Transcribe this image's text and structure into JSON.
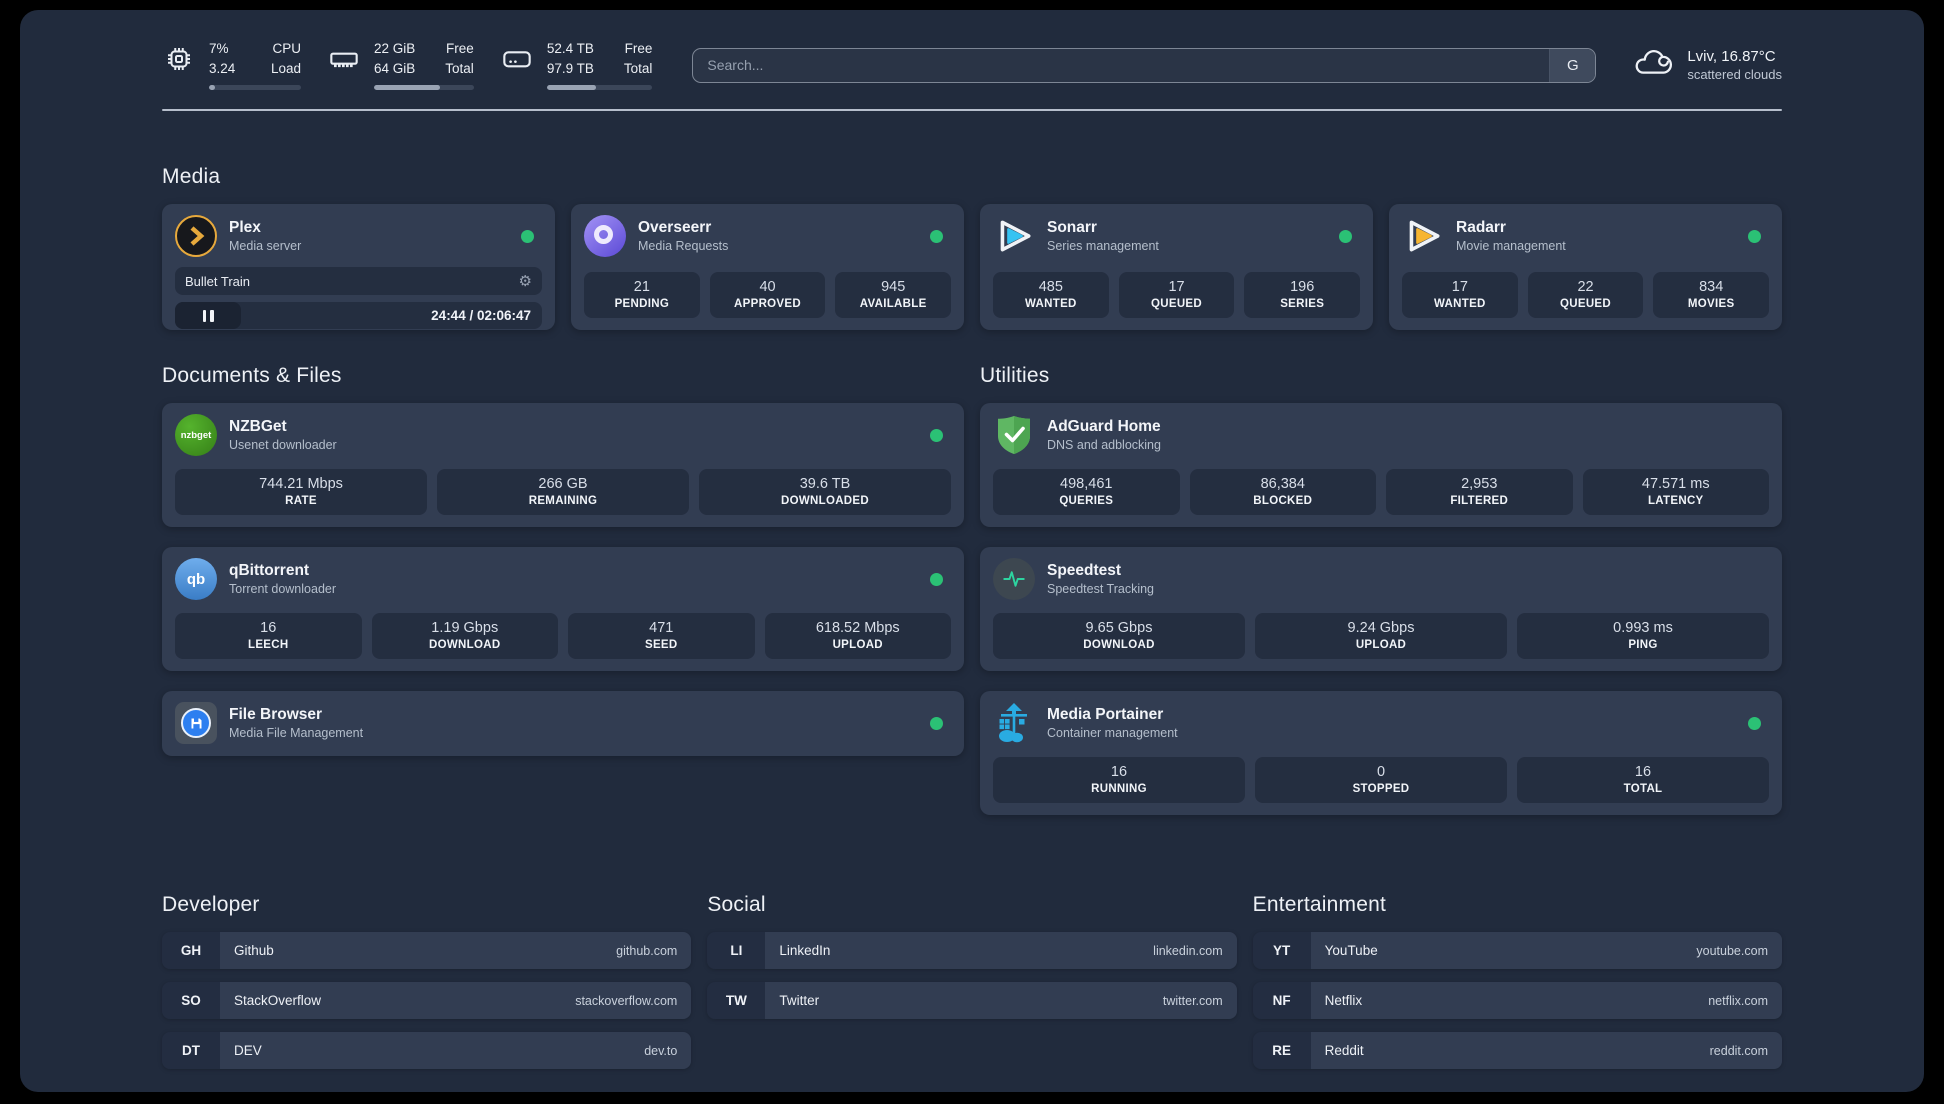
{
  "colors": {
    "background": "#212b3d",
    "card": "#323d52",
    "tile": "#242e40",
    "status_online": "#2bc175",
    "divider": "#c6cedb",
    "plex_accent": "#e7a93c",
    "sonarr_accent": "#36c3f2",
    "radarr_accent": "#f7b530",
    "nzbget_accent": "#42991f",
    "qbittorrent_accent": "#4a90d9",
    "adguard_accent": "#63b663",
    "speedtest_accent": "#2dd4a0",
    "portainer_accent": "#29abe2"
  },
  "icons": {
    "gear": "⚙"
  },
  "header": {
    "cpu": {
      "usage": "7%",
      "load": "3.24",
      "label_top": "CPU",
      "label_bottom": "Load",
      "progress_pct": 7
    },
    "ram": {
      "free": "22 GiB",
      "total": "64 GiB",
      "label_top": "Free",
      "label_bottom": "Total",
      "progress_pct": 66
    },
    "disk": {
      "free": "52.4 TB",
      "total": "97.9 TB",
      "label_top": "Free",
      "label_bottom": "Total",
      "progress_pct": 47
    },
    "search": {
      "placeholder": "Search...",
      "engine": "G"
    },
    "weather": {
      "location": "Lviv, 16.87°C",
      "condition": "scattered clouds"
    }
  },
  "media": {
    "title": "Media",
    "plex": {
      "name": "Plex",
      "desc": "Media server",
      "now_playing": "Bullet Train",
      "time": "24:44 / 02:06:47"
    },
    "overseerr": {
      "name": "Overseerr",
      "desc": "Media Requests",
      "stats": [
        {
          "value": "21",
          "label": "PENDING"
        },
        {
          "value": "40",
          "label": "APPROVED"
        },
        {
          "value": "945",
          "label": "AVAILABLE"
        }
      ]
    },
    "sonarr": {
      "name": "Sonarr",
      "desc": "Series management",
      "stats": [
        {
          "value": "485",
          "label": "WANTED"
        },
        {
          "value": "17",
          "label": "QUEUED"
        },
        {
          "value": "196",
          "label": "SERIES"
        }
      ]
    },
    "radarr": {
      "name": "Radarr",
      "desc": "Movie management",
      "stats": [
        {
          "value": "17",
          "label": "WANTED"
        },
        {
          "value": "22",
          "label": "QUEUED"
        },
        {
          "value": "834",
          "label": "MOVIES"
        }
      ]
    }
  },
  "documents": {
    "title": "Documents & Files",
    "nzbget": {
      "name": "NZBGet",
      "desc": "Usenet downloader",
      "icon_text": "nzbget",
      "stats": [
        {
          "value": "744.21 Mbps",
          "label": "RATE"
        },
        {
          "value": "266 GB",
          "label": "REMAINING"
        },
        {
          "value": "39.6 TB",
          "label": "DOWNLOADED"
        }
      ]
    },
    "qbittorrent": {
      "name": "qBittorrent",
      "desc": "Torrent downloader",
      "icon_text": "qb",
      "stats": [
        {
          "value": "16",
          "label": "LEECH"
        },
        {
          "value": "1.19 Gbps",
          "label": "DOWNLOAD"
        },
        {
          "value": "471",
          "label": "SEED"
        },
        {
          "value": "618.52 Mbps",
          "label": "UPLOAD"
        }
      ]
    },
    "filebrowser": {
      "name": "File Browser",
      "desc": "Media File Management"
    }
  },
  "utilities": {
    "title": "Utilities",
    "adguard": {
      "name": "AdGuard Home",
      "desc": "DNS and adblocking",
      "stats": [
        {
          "value": "498,461",
          "label": "QUERIES"
        },
        {
          "value": "86,384",
          "label": "BLOCKED"
        },
        {
          "value": "2,953",
          "label": "FILTERED"
        },
        {
          "value": "47.571 ms",
          "label": "LATENCY"
        }
      ]
    },
    "speedtest": {
      "name": "Speedtest",
      "desc": "Speedtest Tracking",
      "stats": [
        {
          "value": "9.65 Gbps",
          "label": "DOWNLOAD"
        },
        {
          "value": "9.24 Gbps",
          "label": "UPLOAD"
        },
        {
          "value": "0.993 ms",
          "label": "PING"
        }
      ]
    },
    "portainer": {
      "name": "Media Portainer",
      "desc": "Container management",
      "stats": [
        {
          "value": "16",
          "label": "RUNNING"
        },
        {
          "value": "0",
          "label": "STOPPED"
        },
        {
          "value": "16",
          "label": "TOTAL"
        }
      ]
    }
  },
  "bookmarks": {
    "developer": {
      "title": "Developer",
      "items": [
        {
          "tag": "GH",
          "name": "Github",
          "url": "github.com"
        },
        {
          "tag": "SO",
          "name": "StackOverflow",
          "url": "stackoverflow.com"
        },
        {
          "tag": "DT",
          "name": "DEV",
          "url": "dev.to"
        }
      ]
    },
    "social": {
      "title": "Social",
      "items": [
        {
          "tag": "LI",
          "name": "LinkedIn",
          "url": "linkedin.com"
        },
        {
          "tag": "TW",
          "name": "Twitter",
          "url": "twitter.com"
        }
      ]
    },
    "entertainment": {
      "title": "Entertainment",
      "items": [
        {
          "tag": "YT",
          "name": "YouTube",
          "url": "youtube.com"
        },
        {
          "tag": "NF",
          "name": "Netflix",
          "url": "netflix.com"
        },
        {
          "tag": "RE",
          "name": "Reddit",
          "url": "reddit.com"
        }
      ]
    }
  }
}
